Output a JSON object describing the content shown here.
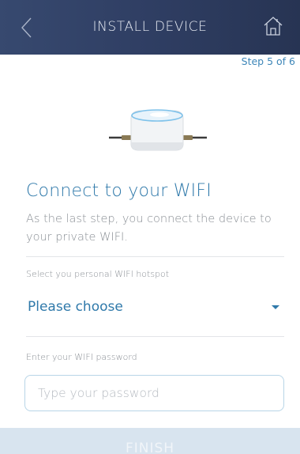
{
  "header": {
    "title": "INSTALL DEVICE",
    "back_icon": "chevron-left-icon",
    "home_icon": "home-icon"
  },
  "step": "Step 5 of 6",
  "main": {
    "title": "Connect to your WIFI",
    "description": "As the last step, you connect the device to your private WIFI."
  },
  "wifi_select": {
    "label": "Select you personal WIFI hotspot",
    "value": "Please choose"
  },
  "password_field": {
    "label": "Enter your WIFI  password",
    "placeholder": "Type your password",
    "value": ""
  },
  "finish_button": {
    "label": "FINISH"
  },
  "colors": {
    "header": "#2f3e63",
    "accent": "#2f79aa",
    "button": "#d8e4ef"
  }
}
